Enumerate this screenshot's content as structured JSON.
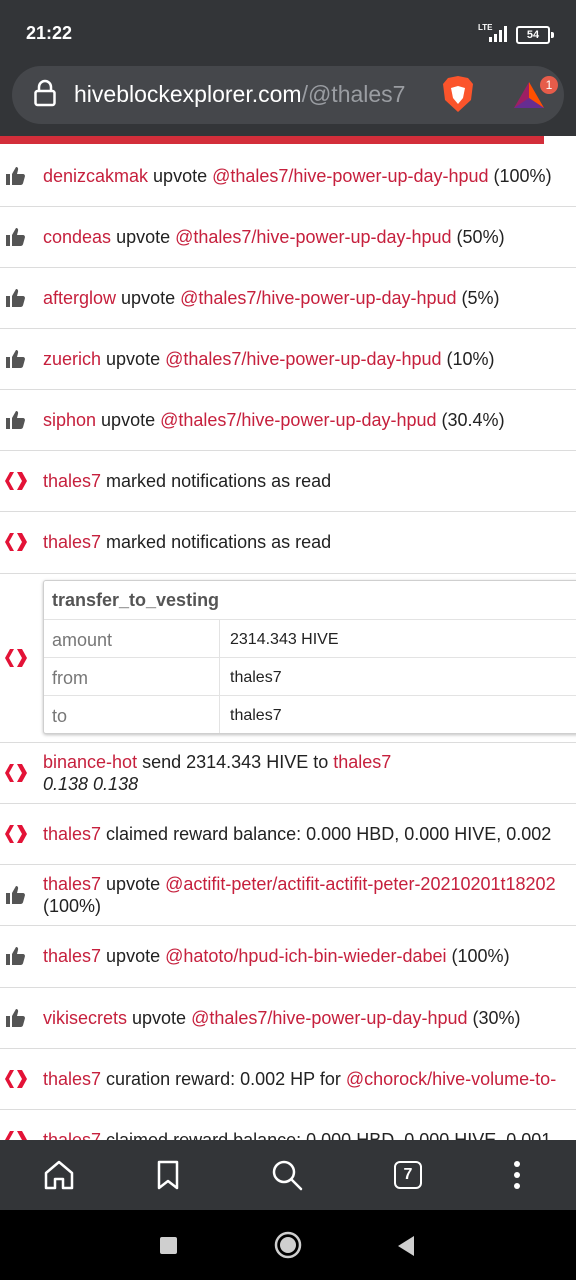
{
  "status": {
    "time": "21:22",
    "network": "LTE",
    "battery": "54"
  },
  "browser": {
    "url_domain": "hiveblockexplorer.com",
    "url_path": "/@thales7",
    "rewards_badge": "1",
    "tab_count": "7"
  },
  "rows": [
    {
      "icon": "thumbs-up-icon",
      "actor": "denizcakmak",
      "verb": " upvote ",
      "link": "@thales7/hive-power-up-day-hpud",
      "tail": " (100%)"
    },
    {
      "icon": "thumbs-up-icon",
      "actor": "condeas",
      "verb": " upvote ",
      "link": "@thales7/hive-power-up-day-hpud",
      "tail": " (50%)"
    },
    {
      "icon": "thumbs-up-icon",
      "actor": "afterglow",
      "verb": " upvote ",
      "link": "@thales7/hive-power-up-day-hpud",
      "tail": " (5%)"
    },
    {
      "icon": "thumbs-up-icon",
      "actor": "zuerich",
      "verb": " upvote ",
      "link": "@thales7/hive-power-up-day-hpud",
      "tail": " (10%)"
    },
    {
      "icon": "thumbs-up-icon",
      "actor": "siphon",
      "verb": " upvote ",
      "link": "@thales7/hive-power-up-day-hpud",
      "tail": " (30.4%)"
    },
    {
      "icon": "hive-logo-icon",
      "actor": "thales7",
      "verb": " marked notifications as read",
      "link": "",
      "tail": ""
    },
    {
      "icon": "hive-logo-icon",
      "actor": "thales7",
      "verb": " marked notifications as read",
      "link": "",
      "tail": ""
    }
  ],
  "transfer": {
    "title": "transfer_to_vesting",
    "fields": [
      {
        "key": "amount",
        "value": "2314.343 HIVE"
      },
      {
        "key": "from",
        "value": "thales7"
      },
      {
        "key": "to",
        "value": "thales7"
      }
    ]
  },
  "send_row": {
    "actor": "binance-hot",
    "verb": " send 2314.343 HIVE to ",
    "target": "thales7",
    "memo": "0.138 0.138"
  },
  "claim_row": {
    "actor": "thales7",
    "verb": " claimed reward balance: 0.000 HBD, 0.000 HIVE, 0.002"
  },
  "vote_wrap_row": {
    "actor": "thales7",
    "verb": " upvote ",
    "link": "@actifit-peter/actifit-actifit-peter-20210201t18202",
    "tail": "(100%)"
  },
  "rows2": [
    {
      "icon": "thumbs-up-icon",
      "actor": "thales7",
      "verb": " upvote ",
      "link": "@hatoto/hpud-ich-bin-wieder-dabei",
      "tail": " (100%)"
    },
    {
      "icon": "thumbs-up-icon",
      "actor": "vikisecrets",
      "verb": " upvote ",
      "link": "@thales7/hive-power-up-day-hpud",
      "tail": " (30%)"
    },
    {
      "icon": "hive-logo-icon",
      "actor": "thales7",
      "verb": " curation reward: 0.002 HP for ",
      "link": "@chorock/hive-volume-to-",
      "tail": ""
    },
    {
      "icon": "hive-logo-icon",
      "actor": "thales7",
      "verb": " claimed reward balance: 0.000 HBD, 0.000 HIVE, 0.001",
      "link": "",
      "tail": ""
    }
  ],
  "colors": {
    "link": "#c6203d",
    "chrome": "#333538",
    "progress": "#d32e3a"
  }
}
